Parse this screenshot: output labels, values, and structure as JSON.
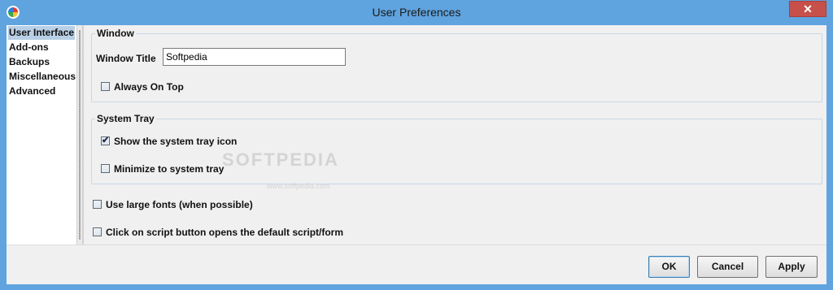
{
  "window": {
    "title": "User Preferences",
    "close_glyph": "✕"
  },
  "sidebar": {
    "items": [
      {
        "label": "User Interface",
        "selected": true
      },
      {
        "label": "Add-ons"
      },
      {
        "label": "Backups"
      },
      {
        "label": "Miscellaneous"
      },
      {
        "label": "Advanced"
      }
    ]
  },
  "window_group": {
    "legend": "Window",
    "title_label": "Window Title",
    "title_value": "Softpedia",
    "always_on_top": {
      "label": "Always On Top",
      "checked": false
    }
  },
  "tray_group": {
    "legend": "System Tray",
    "show_icon": {
      "label": "Show the system tray icon",
      "checked": true
    },
    "minimize": {
      "label": "Minimize to system tray",
      "checked": false
    }
  },
  "options": {
    "large_fonts": {
      "label": "Use large fonts (when possible)",
      "checked": false
    },
    "script_button": {
      "label": "Click on script button opens the default script/form",
      "checked": false
    }
  },
  "watermark": {
    "brand": "SOFTPEDIA",
    "url": "www.softpedia.com"
  },
  "buttons": {
    "ok": "OK",
    "cancel": "Cancel",
    "apply": "Apply"
  },
  "icons": {
    "app": "app-icon",
    "close": "close-icon",
    "check": "✔"
  }
}
